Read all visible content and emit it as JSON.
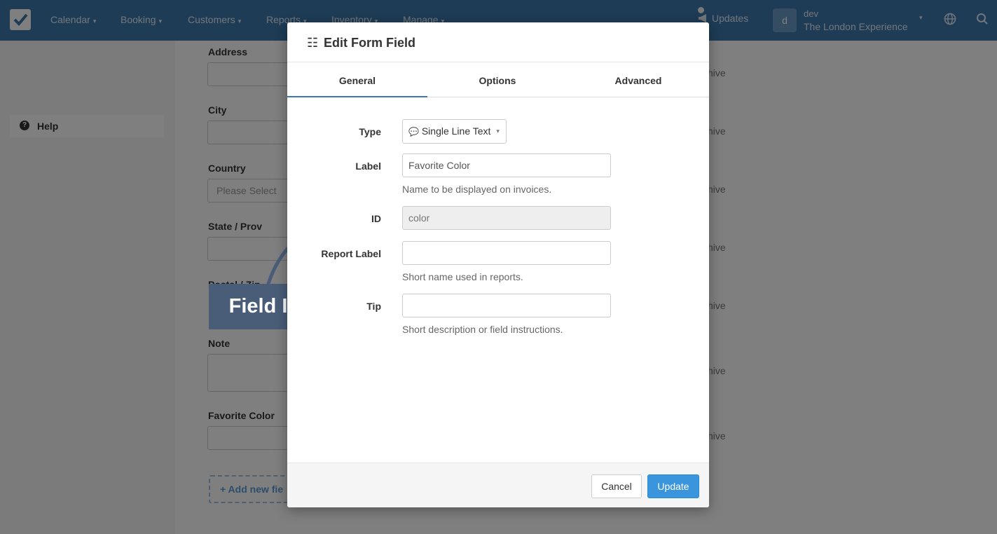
{
  "navbar": {
    "items": [
      {
        "label": "Calendar"
      },
      {
        "label": "Booking"
      },
      {
        "label": "Customers"
      },
      {
        "label": "Reports"
      },
      {
        "label": "Inventory"
      },
      {
        "label": "Manage"
      }
    ],
    "caret": "▾",
    "updates_label": "Updates",
    "user": {
      "avatar_letter": "d",
      "name": "dev",
      "company": "The London Experience"
    }
  },
  "sidebar": {
    "help_label": "Help",
    "help_icon_glyph": "?"
  },
  "background_form": {
    "fields": [
      {
        "label": "Address",
        "value": ""
      },
      {
        "label": "City",
        "value": ""
      },
      {
        "label": "Country",
        "value": "Please Select"
      },
      {
        "label": "State / Prov",
        "value": ""
      },
      {
        "label": "Postal / Zip",
        "value": ""
      },
      {
        "label": "Note",
        "value": ""
      },
      {
        "label": "Favorite Color",
        "value": ""
      }
    ],
    "archive_fragment": "hive",
    "add_new_field_label": "+ Add new fie"
  },
  "annotation": {
    "callout_label": "Field ID"
  },
  "modal": {
    "title_icon": "☷",
    "title": "Edit Form Field",
    "tabs": [
      {
        "label": "General",
        "active": true
      },
      {
        "label": "Options",
        "active": false
      },
      {
        "label": "Advanced",
        "active": false
      }
    ],
    "form": {
      "type": {
        "label": "Type",
        "icon": "💬",
        "value": "Single Line Text"
      },
      "label_field": {
        "label": "Label",
        "value": "Favorite Color",
        "help": "Name to be displayed on invoices."
      },
      "id_field": {
        "label": "ID",
        "placeholder": "color"
      },
      "report_label": {
        "label": "Report Label",
        "value": "",
        "help": "Short name used in reports."
      },
      "tip": {
        "label": "Tip",
        "value": "",
        "help": "Short description or field instructions."
      }
    },
    "footer": {
      "cancel_label": "Cancel",
      "update_label": "Update"
    }
  },
  "colors": {
    "navbar": "#3d79ad",
    "primary_button": "#3a95dd",
    "callout": "#4a5d78",
    "active_tab_underline": "#3d79ad"
  }
}
